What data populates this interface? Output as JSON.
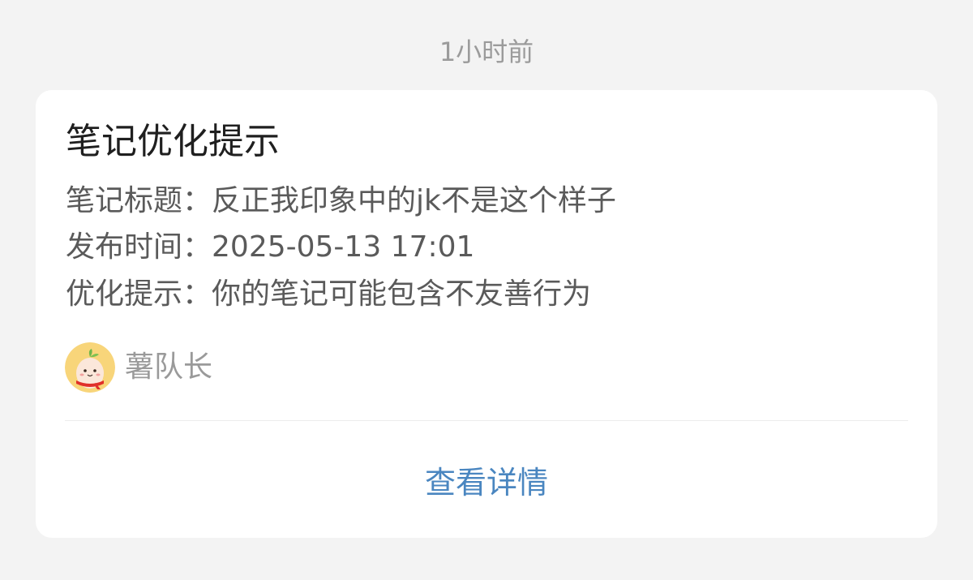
{
  "header": {
    "timestamp": "1小时前"
  },
  "notification": {
    "title": "笔记优化提示",
    "fields": [
      {
        "label": "笔记标题：",
        "value": "反正我印象中的jk不是这个样子"
      },
      {
        "label": "发布时间：",
        "value": "2025-05-13 17:01"
      },
      {
        "label": "优化提示：",
        "value": "你的笔记可能包含不友善行为"
      }
    ],
    "author": {
      "name": "薯队长",
      "avatar_icon": "potato-mascot-avatar"
    },
    "action": {
      "label": "查看详情"
    }
  },
  "colors": {
    "background": "#f3f3f3",
    "card": "#ffffff",
    "link": "#4a86c0",
    "avatar_bg": "#f8d57a",
    "scarf": "#e0302a"
  }
}
